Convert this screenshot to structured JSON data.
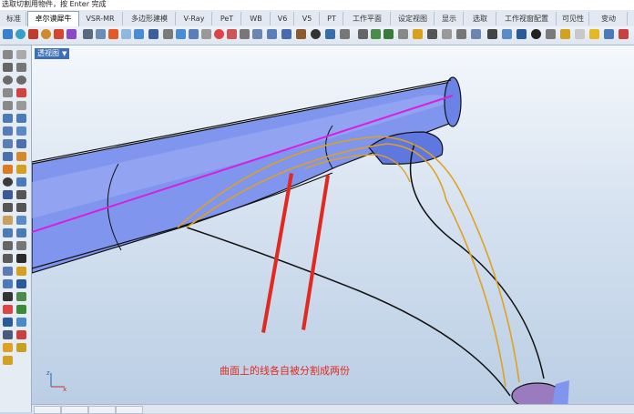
{
  "command_line": {
    "prompt": "选取切割用物件，按 Enter 完成"
  },
  "menu_tabs": [
    {
      "label": "标准"
    },
    {
      "label": "卓尔谟犀牛"
    },
    {
      "label": "VSR-MR"
    },
    {
      "label": "多边形建模"
    },
    {
      "label": "V-Ray"
    },
    {
      "label": "PeT"
    },
    {
      "label": "WB"
    },
    {
      "label": "V6"
    },
    {
      "label": "V5"
    },
    {
      "label": "PT"
    },
    {
      "label": "工作平面"
    },
    {
      "label": "设定视图"
    },
    {
      "label": "显示"
    },
    {
      "label": "选取"
    },
    {
      "label": "工作视窗配置"
    },
    {
      "label": "可见性"
    },
    {
      "label": "变动"
    }
  ],
  "active_tab_index": 1,
  "viewport": {
    "label": "透视图",
    "view_menu_arrow": "▼"
  },
  "annotation": {
    "text": "曲面上的线各自被分割成两份"
  },
  "axis": {
    "x": "x",
    "z": "z"
  },
  "colors": {
    "surface": "#7f95ee",
    "trim_curve": "#e0a020",
    "seam_curve": "#d81fe0",
    "edge_curve": "#111111",
    "annotation_arrow": "#e02a20",
    "active_tab": "#ffffff",
    "viewport_label_bg": "#3d6fb6"
  }
}
